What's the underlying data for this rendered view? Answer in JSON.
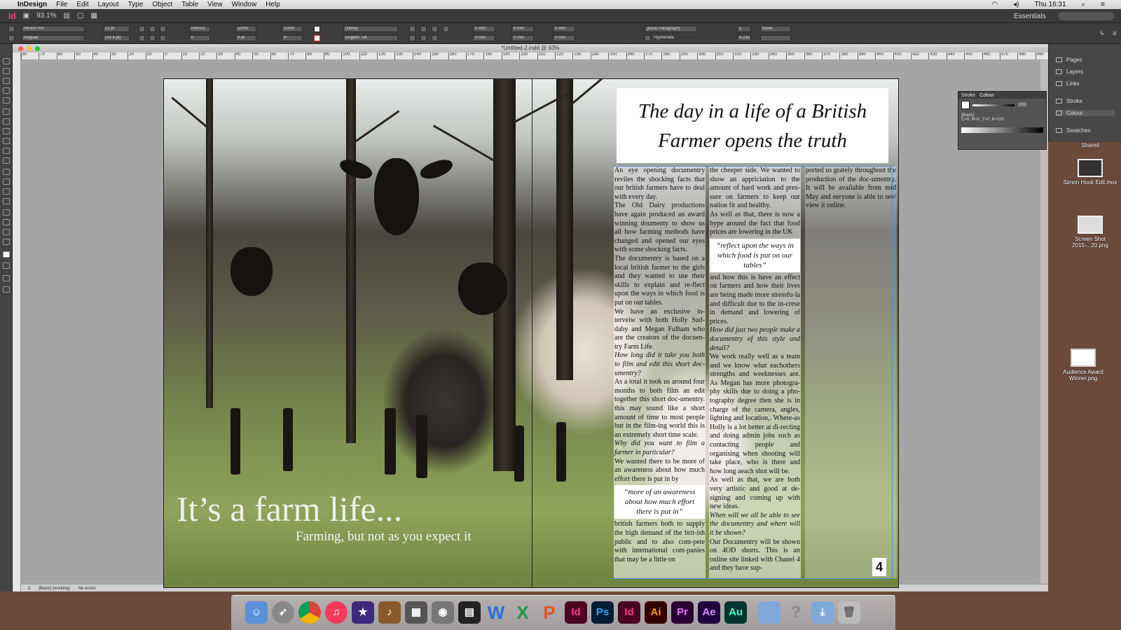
{
  "menubar": {
    "apple": "",
    "app": "InDesign",
    "items": [
      "File",
      "Edit",
      "Layout",
      "Type",
      "Object",
      "Table",
      "View",
      "Window",
      "Help"
    ],
    "clock": "Thu 16:31"
  },
  "appbar": {
    "logo": "Id",
    "zoom": "93.1%",
    "workspace": "Essentials"
  },
  "control": {
    "font_family": "Minion Pro",
    "font_style": "Regular",
    "font_size": "12 pt",
    "leading": "(14.4 pt)",
    "kerning": "Metrics",
    "tracking": "0",
    "h_scale": "100%",
    "v_scale": "100%",
    "baseline": "0 pt",
    "skew": "0°",
    "char_style": "[None]",
    "language": "English: UK",
    "para_style": "[Basic Paragraph]",
    "hyphenate": "Hyphenate",
    "indent_fields": [
      "0 mm",
      "0 mm",
      "0 mm",
      "0 mm",
      "0 mm",
      "0 mm"
    ],
    "bullet": "None",
    "columns": "1",
    "gutter": "4.233"
  },
  "document": {
    "title": "*Untitled-2.indd @ 93%"
  },
  "ruler": [
    "80",
    "70",
    "60",
    "50",
    "40",
    "30",
    "20",
    "10",
    "0",
    "10",
    "20",
    "30",
    "40",
    "50",
    "60",
    "70",
    "80",
    "90",
    "100",
    "110",
    "120",
    "130",
    "140",
    "150",
    "160",
    "170",
    "180",
    "190",
    "200",
    "210",
    "220",
    "230",
    "240",
    "250",
    "260",
    "270",
    "280",
    "290",
    "300",
    "310",
    "320",
    "330",
    "340",
    "350",
    "360",
    "370",
    "380",
    "390",
    "400",
    "410",
    "420",
    "430",
    "440",
    "450",
    "460",
    "470",
    "480",
    "490",
    "500"
  ],
  "status": {
    "page": "2",
    "style": "[Basic] (working)",
    "errors": "No errors"
  },
  "spread": {
    "big_title": "It’s a farm life...",
    "subtitle": "Farming, but not as you expect it",
    "headline_1": "The day in a life of a British",
    "headline_2": "Farmer opens the truth",
    "col1": [
      {
        "t": "An eye opening documentry reviles the shocking facts that our british farmers have to deal with every day."
      },
      {
        "t": "The Old Dairy productions have again produced an award winning doumenty to show us all how farming methods have changed and opened our eyes with some shocking facts."
      },
      {
        "t": "The documentry is based on a local british farmer to the girls and they wanted to use their skills to explain and re-flect upon the ways in which food is put on our tables."
      },
      {
        "t": "We have an exclusive in-terveiw with both Holly Sud-daby and Megan Fulham who are the creators of the docuen-try Farm Life."
      },
      {
        "t": "How long did it take you both to film and edit this short doc-umentry?",
        "q": true
      },
      {
        "t": "As a total it took us around four months to both film an edit together this short doc-umentry. this may sound like a short amount of time to most people but in the film-ing world this is an extremely short time scale."
      },
      {
        "t": "Why did you want to film a farmer in particular?",
        "q": true
      },
      {
        "t": "We wanted there to be more of an awareness about how much effort there is put in by"
      }
    ],
    "pull1": "“more of an awareness about how much effort there is put in”",
    "col1_end": "british farmers both to supply the high demand of the brit-ish public and to also com-pete with international com-panies that may be a little on",
    "col2": [
      {
        "t": "the cheeper side. We wanted to show an appriciation to the amount of hard work and pres-sure on farmers to keep our nation fit and healthy."
      },
      {
        "t": "As well as that, there is now a hype around the fact that food prices are lowering in the UK"
      }
    ],
    "pull2": "“reflect upon the ways in which food is put on our tables”",
    "col2_end": [
      {
        "t": "and how this is have an effect on farmers and how their lives are being made more stressfu-la and difficult due to the in-crese in demand and lowering of prices."
      },
      {
        "t": "How did just two people make a documentry of this style and detail?",
        "q": true
      },
      {
        "t": "We work really well as a team and we know what eachothers strengths and weeknesses are. As Megan has more photogra-phy skills due to doing a pho-tography degree then she is in charge of the camera, angles, lighting and location,. Where-as Holly is a lot better at di-recting and doing admin jobs such as contacting people and organising when shooting will take place, who is there and how long aeach shot will be."
      },
      {
        "t": "As well as that, we are both very artistic and good at de-signing and coming up with new ideas."
      },
      {
        "t": "When will we all be able to see the documentry and where will it be shown?",
        "q": true
      },
      {
        "t": "Our Documentry will be shown on 4OD shorts. This is an online site linked with Chanel 4 and they have sup-"
      }
    ],
    "col3": "ported us grately throughout the production of the doc-umentry. It will be available from mid May and eeryone is able to see/ view it online.",
    "logo": "4"
  },
  "panels": {
    "items": [
      "Pages",
      "Layers",
      "Links",
      "Stroke",
      "Colour",
      "Swatches"
    ],
    "colour_tabs": [
      "Stroke",
      "Colour"
    ],
    "tint": "100",
    "swatch_name": "[Black]",
    "swatch_value": "C=0, M=0, Y=0, K=100"
  },
  "desktop": [
    {
      "label": "Shared"
    },
    {
      "label": "Simon Hook Edit.mov"
    },
    {
      "label": "Screen Shot 2015-...20.png"
    },
    {
      "label": "Audience Award Winner.png"
    }
  ],
  "dock": [
    "Finder",
    "Launchpad",
    "Chrome",
    "iTunes",
    "iMovie",
    "GarageBand",
    "Photo",
    "Preview",
    "Final Cut",
    "Word",
    "Excel",
    "PowerPoint",
    "Id",
    "Ps",
    "Id",
    "Ai",
    "Pr",
    "Ae",
    "Au",
    "Folder",
    "Help",
    "Downloads",
    "Trash"
  ],
  "colors": {
    "accent": "#4d8fe0",
    "indesign": "#ff3a8c"
  }
}
